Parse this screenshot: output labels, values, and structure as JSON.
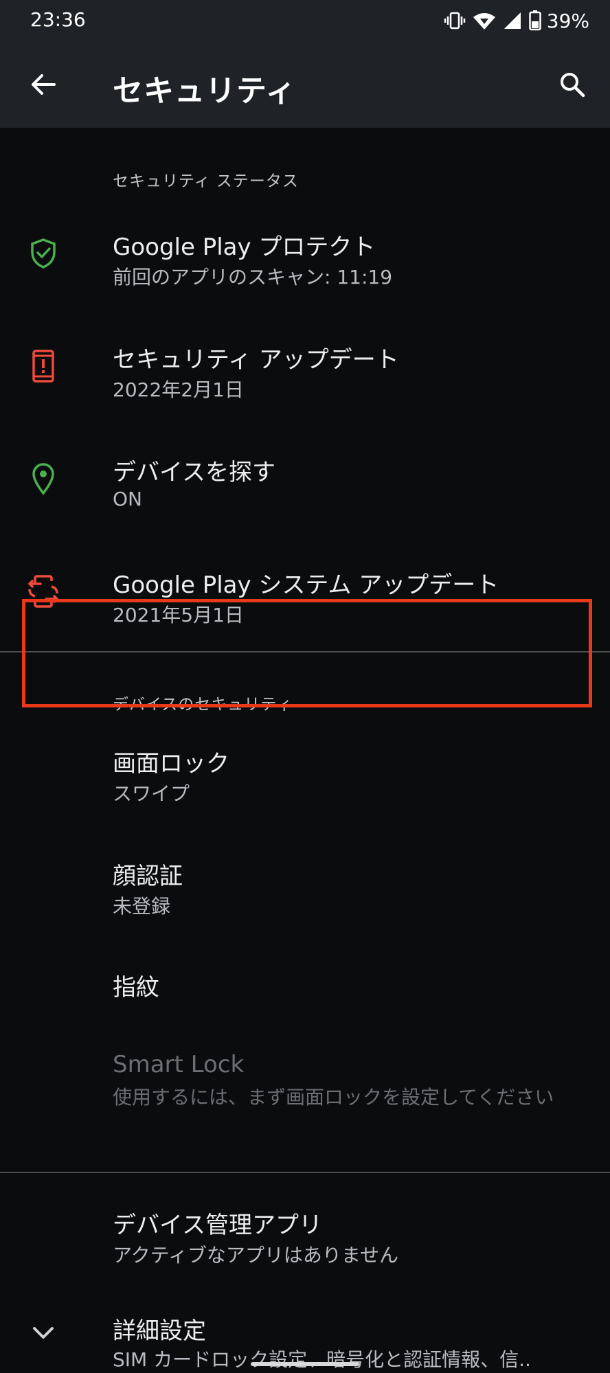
{
  "status_bar": {
    "time": "23:36",
    "battery": "39%",
    "icons": [
      "vibrate-icon",
      "wifi-icon",
      "signal-icon",
      "battery-icon"
    ]
  },
  "app_bar": {
    "title": "セキュリティ",
    "back_icon": "arrow-left-icon",
    "search_icon": "search-icon"
  },
  "sections": {
    "security_status": {
      "header": "セキュリティ ステータス",
      "items": [
        {
          "title": "Google Play プロテクト",
          "subtitle": "前回のアプリのスキャン: 11:19",
          "icon": "shield-check-icon",
          "color": "#4caf50"
        },
        {
          "title": "セキュリティ アップデート",
          "subtitle": "2022年2月1日",
          "icon": "phone-alert-icon",
          "color": "#f04a3b"
        },
        {
          "title": "デバイスを探す",
          "subtitle": "ON",
          "icon": "location-pin-icon",
          "color": "#4caf50"
        },
        {
          "title": "Google Play システム アップデート",
          "subtitle": "2021年5月1日",
          "icon": "phone-sync-icon",
          "color": "#f04a3b"
        }
      ]
    },
    "device_security": {
      "header": "デバイスのセキュリティ",
      "items": [
        {
          "title": "画面ロック",
          "subtitle": "スワイプ"
        },
        {
          "title": "顔認証",
          "subtitle": "未登録"
        },
        {
          "title": "指紋"
        },
        {
          "title": "Smart Lock",
          "subtitle": "使用するには、まず画面ロックを設定してください",
          "disabled": true
        }
      ]
    },
    "other": {
      "items": [
        {
          "title": "デバイス管理アプリ",
          "subtitle": "アクティブなアプリはありません"
        },
        {
          "title": "詳細設定",
          "subtitle": "SIM カードロック設定、暗号化と認証情報、信..",
          "icon": "chevron-down-icon"
        }
      ]
    }
  },
  "colors": {
    "background": "#0b0c0e",
    "app_bar": "#1f2226",
    "highlight": "#e8391a",
    "green": "#4caf50",
    "red": "#f04a3b"
  }
}
